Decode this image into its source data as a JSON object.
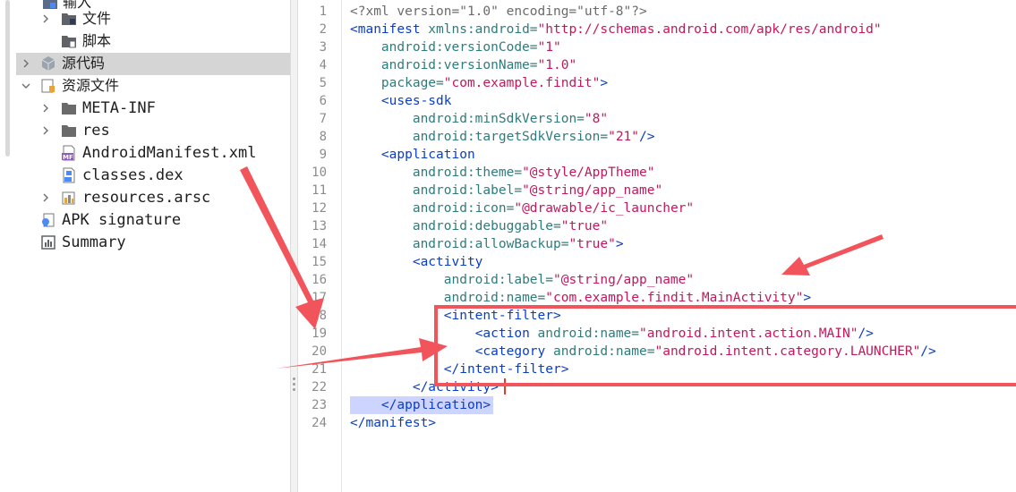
{
  "tree": {
    "items": [
      {
        "label": "输入",
        "font": "cjk"
      },
      {
        "label": "文件",
        "font": "cjk"
      },
      {
        "label": "脚本",
        "font": "cjk"
      },
      {
        "label": "源代码",
        "font": "cjk"
      },
      {
        "label": "资源文件",
        "font": "cjk"
      },
      {
        "label": "META-INF",
        "font": "mono"
      },
      {
        "label": "res",
        "font": "mono"
      },
      {
        "label": "AndroidManifest.xml",
        "font": "mono"
      },
      {
        "label": "classes.dex",
        "font": "mono"
      },
      {
        "label": "resources.arsc",
        "font": "mono"
      },
      {
        "label": "APK signature",
        "font": "mono"
      },
      {
        "label": "Summary",
        "font": "mono"
      }
    ],
    "icons": {
      "manifest_badge": "MF"
    },
    "selected_index": 3
  },
  "editor": {
    "highlighted_line": 23,
    "line_numbers": [
      "1",
      "2",
      "3",
      "4",
      "5",
      "6",
      "7",
      "8",
      "9",
      "10",
      "11",
      "12",
      "13",
      "14",
      "15",
      "16",
      "17",
      "18",
      "19",
      "20",
      "21",
      "22",
      "23",
      "24"
    ],
    "lines": [
      [
        [
          "decl",
          "<?xml version=\"1.0\" encoding=\"utf-8\"?>"
        ]
      ],
      [
        [
          "tag",
          "<manifest"
        ],
        [
          "attr",
          " xmlns:android="
        ],
        [
          "val",
          "\"http://schemas.android.com/apk/res/android\""
        ]
      ],
      [
        [
          "pun",
          "    "
        ],
        [
          "attr",
          "android:versionCode="
        ],
        [
          "val",
          "\"1\""
        ]
      ],
      [
        [
          "pun",
          "    "
        ],
        [
          "attr",
          "android:versionName="
        ],
        [
          "val",
          "\"1.0\""
        ]
      ],
      [
        [
          "pun",
          "    "
        ],
        [
          "attr",
          "package="
        ],
        [
          "val",
          "\"com.example.findit\""
        ],
        [
          "tag",
          ">"
        ]
      ],
      [
        [
          "pun",
          "    "
        ],
        [
          "tag",
          "<uses-sdk"
        ]
      ],
      [
        [
          "pun",
          "        "
        ],
        [
          "attr",
          "android:minSdkVersion="
        ],
        [
          "val",
          "\"8\""
        ]
      ],
      [
        [
          "pun",
          "        "
        ],
        [
          "attr",
          "android:targetSdkVersion="
        ],
        [
          "val",
          "\"21\""
        ],
        [
          "tag",
          "/>"
        ]
      ],
      [
        [
          "pun",
          "    "
        ],
        [
          "tag",
          "<application"
        ]
      ],
      [
        [
          "pun",
          "        "
        ],
        [
          "attr",
          "android:theme="
        ],
        [
          "val",
          "\"@style/AppTheme\""
        ]
      ],
      [
        [
          "pun",
          "        "
        ],
        [
          "attr",
          "android:label="
        ],
        [
          "val",
          "\"@string/app_name\""
        ]
      ],
      [
        [
          "pun",
          "        "
        ],
        [
          "attr",
          "android:icon="
        ],
        [
          "val",
          "\"@drawable/ic_launcher\""
        ]
      ],
      [
        [
          "pun",
          "        "
        ],
        [
          "attr",
          "android:debuggable="
        ],
        [
          "val",
          "\"true\""
        ]
      ],
      [
        [
          "pun",
          "        "
        ],
        [
          "attr",
          "android:allowBackup="
        ],
        [
          "val",
          "\"true\""
        ],
        [
          "tag",
          ">"
        ]
      ],
      [
        [
          "pun",
          "        "
        ],
        [
          "tag",
          "<activity"
        ]
      ],
      [
        [
          "pun",
          "            "
        ],
        [
          "attr",
          "android:label="
        ],
        [
          "val",
          "\"@string/app_name\""
        ]
      ],
      [
        [
          "pun",
          "            "
        ],
        [
          "attr",
          "android:name="
        ],
        [
          "val",
          "\"com.example.findit.MainActivity\""
        ],
        [
          "tag",
          ">"
        ]
      ],
      [
        [
          "pun",
          "            "
        ],
        [
          "tag",
          "<intent-filter>"
        ]
      ],
      [
        [
          "pun",
          "                "
        ],
        [
          "tag",
          "<action"
        ],
        [
          "attr",
          " android:name="
        ],
        [
          "val",
          "\"android.intent.action.MAIN\""
        ],
        [
          "tag",
          "/>"
        ]
      ],
      [
        [
          "pun",
          "                "
        ],
        [
          "tag",
          "<category"
        ],
        [
          "attr",
          " android:name="
        ],
        [
          "val",
          "\"android.intent.category.LAUNCHER\""
        ],
        [
          "tag",
          "/>"
        ]
      ],
      [
        [
          "pun",
          "            "
        ],
        [
          "tag",
          "</intent-filter>"
        ]
      ],
      [
        [
          "pun",
          "        "
        ],
        [
          "tag",
          "</activity>"
        ]
      ],
      [
        [
          "pun",
          "    "
        ],
        [
          "tag",
          "</application>"
        ]
      ],
      [
        [
          "tag",
          "</manifest>"
        ]
      ]
    ]
  },
  "colors": {
    "annotation": "#f2545b",
    "tag": "#0a3dc4",
    "attr": "#2f7b7b",
    "value": "#c2185b",
    "selection": "#cdd4ff"
  }
}
